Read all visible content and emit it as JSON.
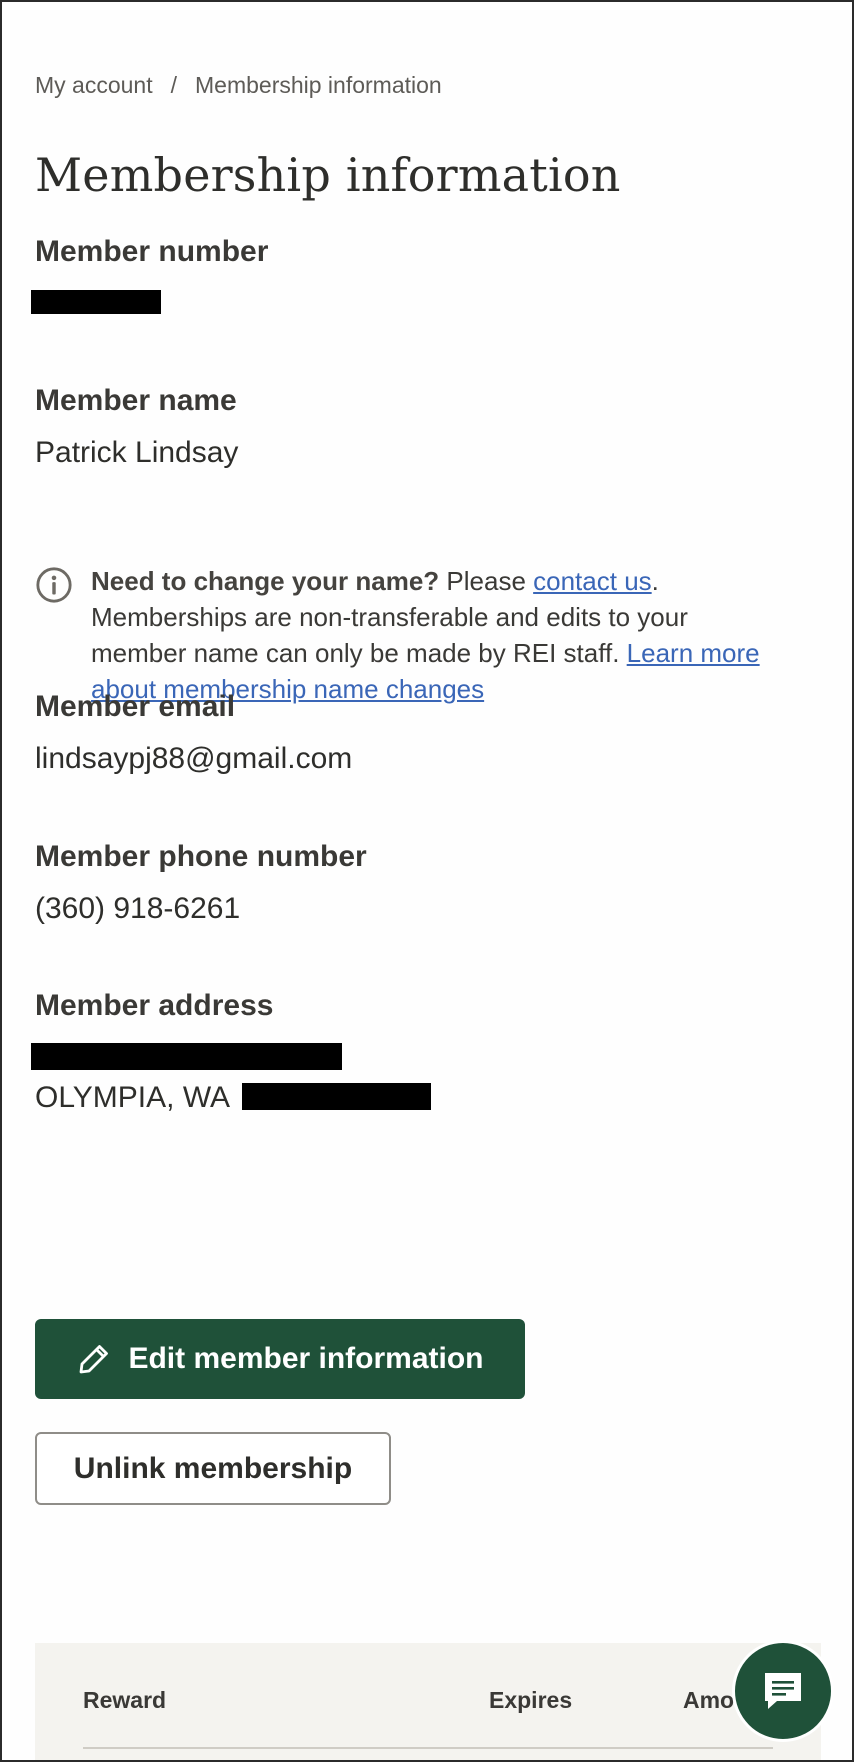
{
  "breadcrumb": {
    "parent": "My account",
    "separator": "/",
    "current": "Membership information"
  },
  "page_title": "Membership information",
  "member_number": {
    "label": "Member number"
  },
  "member_name": {
    "label": "Member name",
    "value": "Patrick Lindsay"
  },
  "name_notice": {
    "bold": "Need to change your name?",
    "pre_link": " Please ",
    "contact_link": "contact us",
    "mid": ". Memberships are non-transferable and edits to your member name can only be made by REI staff. ",
    "learn_link": "Learn more about membership name changes"
  },
  "member_email": {
    "label": "Member email",
    "value": "lindsaypj88@gmail.com"
  },
  "member_phone": {
    "label": "Member phone number",
    "value": "(360) 918-6261"
  },
  "member_address": {
    "label": "Member address",
    "city_state": "OLYMPIA, WA"
  },
  "buttons": {
    "edit": "Edit member information",
    "unlink": "Unlink membership"
  },
  "rewards_table": {
    "columns": [
      "Reward",
      "Expires",
      "Amo"
    ]
  },
  "icons": {
    "info": "info-circle-icon",
    "edit": "pencil-icon",
    "chat": "chat-bubble-icon"
  },
  "colors": {
    "primary_green": "#1f5139",
    "link_blue": "#3a66b7",
    "text_dark": "#2e2e2b",
    "table_bg": "#f4f3ef"
  }
}
